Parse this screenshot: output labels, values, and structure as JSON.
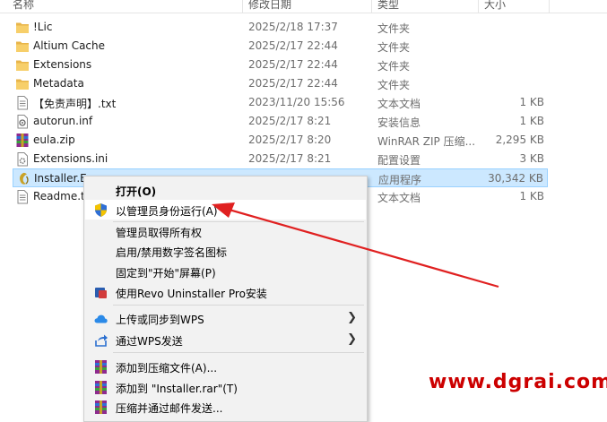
{
  "header": {
    "col_name": "名称",
    "col_date": "修改日期",
    "col_type": "类型",
    "col_size": "大小"
  },
  "files": [
    {
      "name": "!Lic",
      "date": "2025/2/18 17:37",
      "type": "文件夹",
      "size": "",
      "icon": "folder-icon"
    },
    {
      "name": "Altium Cache",
      "date": "2025/2/17 22:44",
      "type": "文件夹",
      "size": "",
      "icon": "folder-icon"
    },
    {
      "name": "Extensions",
      "date": "2025/2/17 22:44",
      "type": "文件夹",
      "size": "",
      "icon": "folder-icon"
    },
    {
      "name": "Metadata",
      "date": "2025/2/17 22:44",
      "type": "文件夹",
      "size": "",
      "icon": "folder-icon"
    },
    {
      "name": "【免责声明】.txt",
      "date": "2023/11/20 15:56",
      "type": "文本文档",
      "size": "1 KB",
      "icon": "text-file-icon"
    },
    {
      "name": "autorun.inf",
      "date": "2025/2/17 8:21",
      "type": "安装信息",
      "size": "1 KB",
      "icon": "setup-info-icon"
    },
    {
      "name": "eula.zip",
      "date": "2025/2/17 8:20",
      "type": "WinRAR ZIP 压缩...",
      "size": "2,295 KB",
      "icon": "winrar-zip-icon"
    },
    {
      "name": "Extensions.ini",
      "date": "2025/2/17 8:21",
      "type": "配置设置",
      "size": "3 KB",
      "icon": "config-file-icon"
    },
    {
      "name": "Installer.E",
      "date": "",
      "type": "应用程序",
      "size": "30,342 KB",
      "icon": "installer-exe-icon",
      "selected": true
    },
    {
      "name": "Readme.t",
      "date": "",
      "type": "文本文档",
      "size": "1 KB",
      "icon": "text-file-icon"
    }
  ],
  "context_menu": {
    "open": "打开(O)",
    "run_as_admin": "以管理员身份运行(A)",
    "take_ownership": "管理员取得所有权",
    "toggle_signature": "启用/禁用数字签名图标",
    "pin_to_start": "固定到\"开始\"屏幕(P)",
    "revo_install": "使用Revo Uninstaller Pro安装",
    "upload_wps": "上传或同步到WPS",
    "send_wps": "通过WPS发送",
    "add_to_archive": "添加到压缩文件(A)...",
    "add_to_rar": "添加到 \"Installer.rar\"(T)",
    "compress_email": "压缩并通过邮件发送..."
  },
  "watermark": "www.dgrai.com",
  "colors": {
    "selection": "#cce8ff",
    "arrow": "#e02020",
    "watermark": "#cc0000",
    "folder": "#f2c55c"
  }
}
